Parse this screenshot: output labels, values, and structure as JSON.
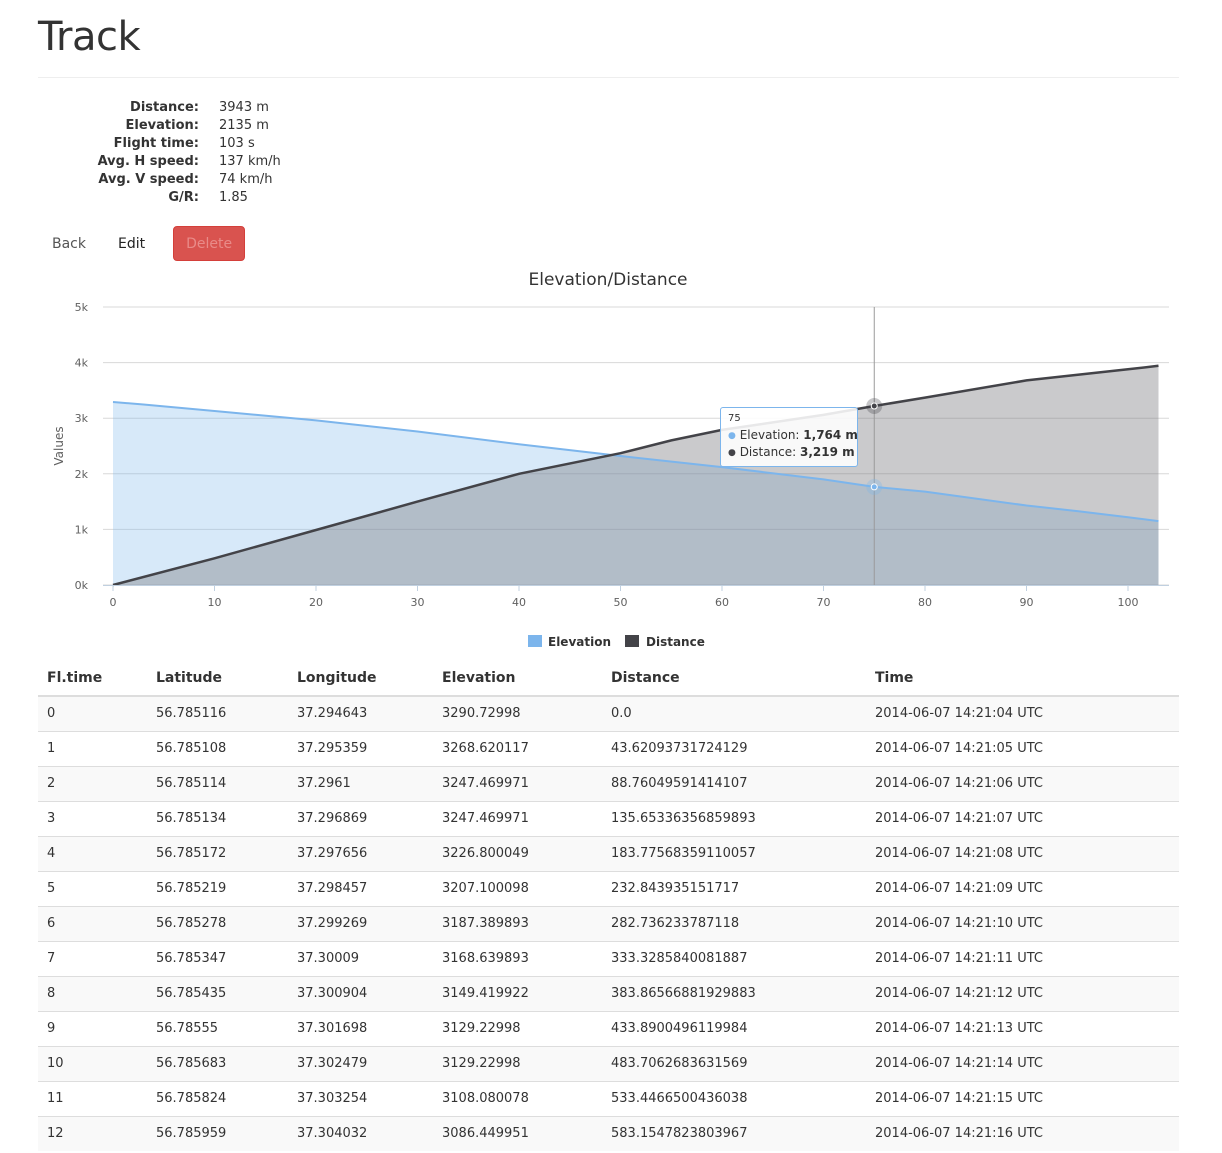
{
  "page": {
    "title": "Track"
  },
  "stats": [
    {
      "label": "Distance:",
      "value": "3943 m"
    },
    {
      "label": "Elevation:",
      "value": "2135 m"
    },
    {
      "label": "Flight time:",
      "value": "103 s"
    },
    {
      "label": "Avg. H speed:",
      "value": "137 km/h"
    },
    {
      "label": "Avg. V speed:",
      "value": "74 km/h"
    },
    {
      "label": "G/R:",
      "value": "1.85"
    }
  ],
  "actions": {
    "back": "Back",
    "edit": "Edit",
    "delete": "Delete"
  },
  "colors": {
    "elevation": "#7cb5ec",
    "distance": "#434348",
    "danger": "#d9534f"
  },
  "chart_data": {
    "type": "area",
    "title": "Elevation/Distance",
    "ylabel": "Values",
    "xlabel": "",
    "xlim": [
      0,
      103
    ],
    "ylim": [
      0,
      5000
    ],
    "x_ticks": [
      "0",
      "10",
      "20",
      "30",
      "40",
      "50",
      "60",
      "70",
      "80",
      "90",
      "100"
    ],
    "y_ticks": [
      "0k",
      "1k",
      "2k",
      "3k",
      "4k",
      "5k"
    ],
    "grid": true,
    "legend": "bottom-center",
    "series": [
      {
        "name": "Elevation",
        "color": "#7cb5ec",
        "points": [
          [
            0,
            3291
          ],
          [
            3,
            3247
          ],
          [
            10,
            3130
          ],
          [
            20,
            2960
          ],
          [
            30,
            2760
          ],
          [
            40,
            2530
          ],
          [
            50,
            2320
          ],
          [
            60,
            2120
          ],
          [
            70,
            1900
          ],
          [
            75,
            1764
          ],
          [
            80,
            1680
          ],
          [
            90,
            1430
          ],
          [
            95,
            1330
          ],
          [
            100,
            1220
          ],
          [
            103,
            1150
          ]
        ]
      },
      {
        "name": "Distance",
        "color": "#434348",
        "points": [
          [
            0,
            0
          ],
          [
            10,
            480
          ],
          [
            20,
            990
          ],
          [
            30,
            1500
          ],
          [
            40,
            2000
          ],
          [
            50,
            2370
          ],
          [
            55,
            2600
          ],
          [
            60,
            2790
          ],
          [
            70,
            3060
          ],
          [
            75,
            3219
          ],
          [
            80,
            3370
          ],
          [
            90,
            3680
          ],
          [
            100,
            3880
          ],
          [
            103,
            3943
          ]
        ]
      }
    ],
    "tooltip": {
      "x": "75",
      "items": [
        {
          "label": "Elevation: ",
          "value": "1,764 m"
        },
        {
          "label": "Distance: ",
          "value": "3,219 m"
        }
      ]
    }
  },
  "table": {
    "columns": [
      "Fl.time",
      "Latitude",
      "Longitude",
      "Elevation",
      "Distance",
      "Time"
    ],
    "rows": [
      [
        "0",
        "56.785116",
        "37.294643",
        "3290.72998",
        "0.0",
        "2014-06-07 14:21:04 UTC"
      ],
      [
        "1",
        "56.785108",
        "37.295359",
        "3268.620117",
        "43.62093731724129",
        "2014-06-07 14:21:05 UTC"
      ],
      [
        "2",
        "56.785114",
        "37.2961",
        "3247.469971",
        "88.76049591414107",
        "2014-06-07 14:21:06 UTC"
      ],
      [
        "3",
        "56.785134",
        "37.296869",
        "3247.469971",
        "135.65336356859893",
        "2014-06-07 14:21:07 UTC"
      ],
      [
        "4",
        "56.785172",
        "37.297656",
        "3226.800049",
        "183.77568359110057",
        "2014-06-07 14:21:08 UTC"
      ],
      [
        "5",
        "56.785219",
        "37.298457",
        "3207.100098",
        "232.843935151717",
        "2014-06-07 14:21:09 UTC"
      ],
      [
        "6",
        "56.785278",
        "37.299269",
        "3187.389893",
        "282.736233787118",
        "2014-06-07 14:21:10 UTC"
      ],
      [
        "7",
        "56.785347",
        "37.30009",
        "3168.639893",
        "333.3285840081887",
        "2014-06-07 14:21:11 UTC"
      ],
      [
        "8",
        "56.785435",
        "37.300904",
        "3149.419922",
        "383.86566881929883",
        "2014-06-07 14:21:12 UTC"
      ],
      [
        "9",
        "56.78555",
        "37.301698",
        "3129.22998",
        "433.8900496119984",
        "2014-06-07 14:21:13 UTC"
      ],
      [
        "10",
        "56.785683",
        "37.302479",
        "3129.22998",
        "483.7062683631569",
        "2014-06-07 14:21:14 UTC"
      ],
      [
        "11",
        "56.785824",
        "37.303254",
        "3108.080078",
        "533.4466500436038",
        "2014-06-07 14:21:15 UTC"
      ],
      [
        "12",
        "56.785959",
        "37.304032",
        "3086.449951",
        "583.1547823803967",
        "2014-06-07 14:21:16 UTC"
      ]
    ]
  }
}
